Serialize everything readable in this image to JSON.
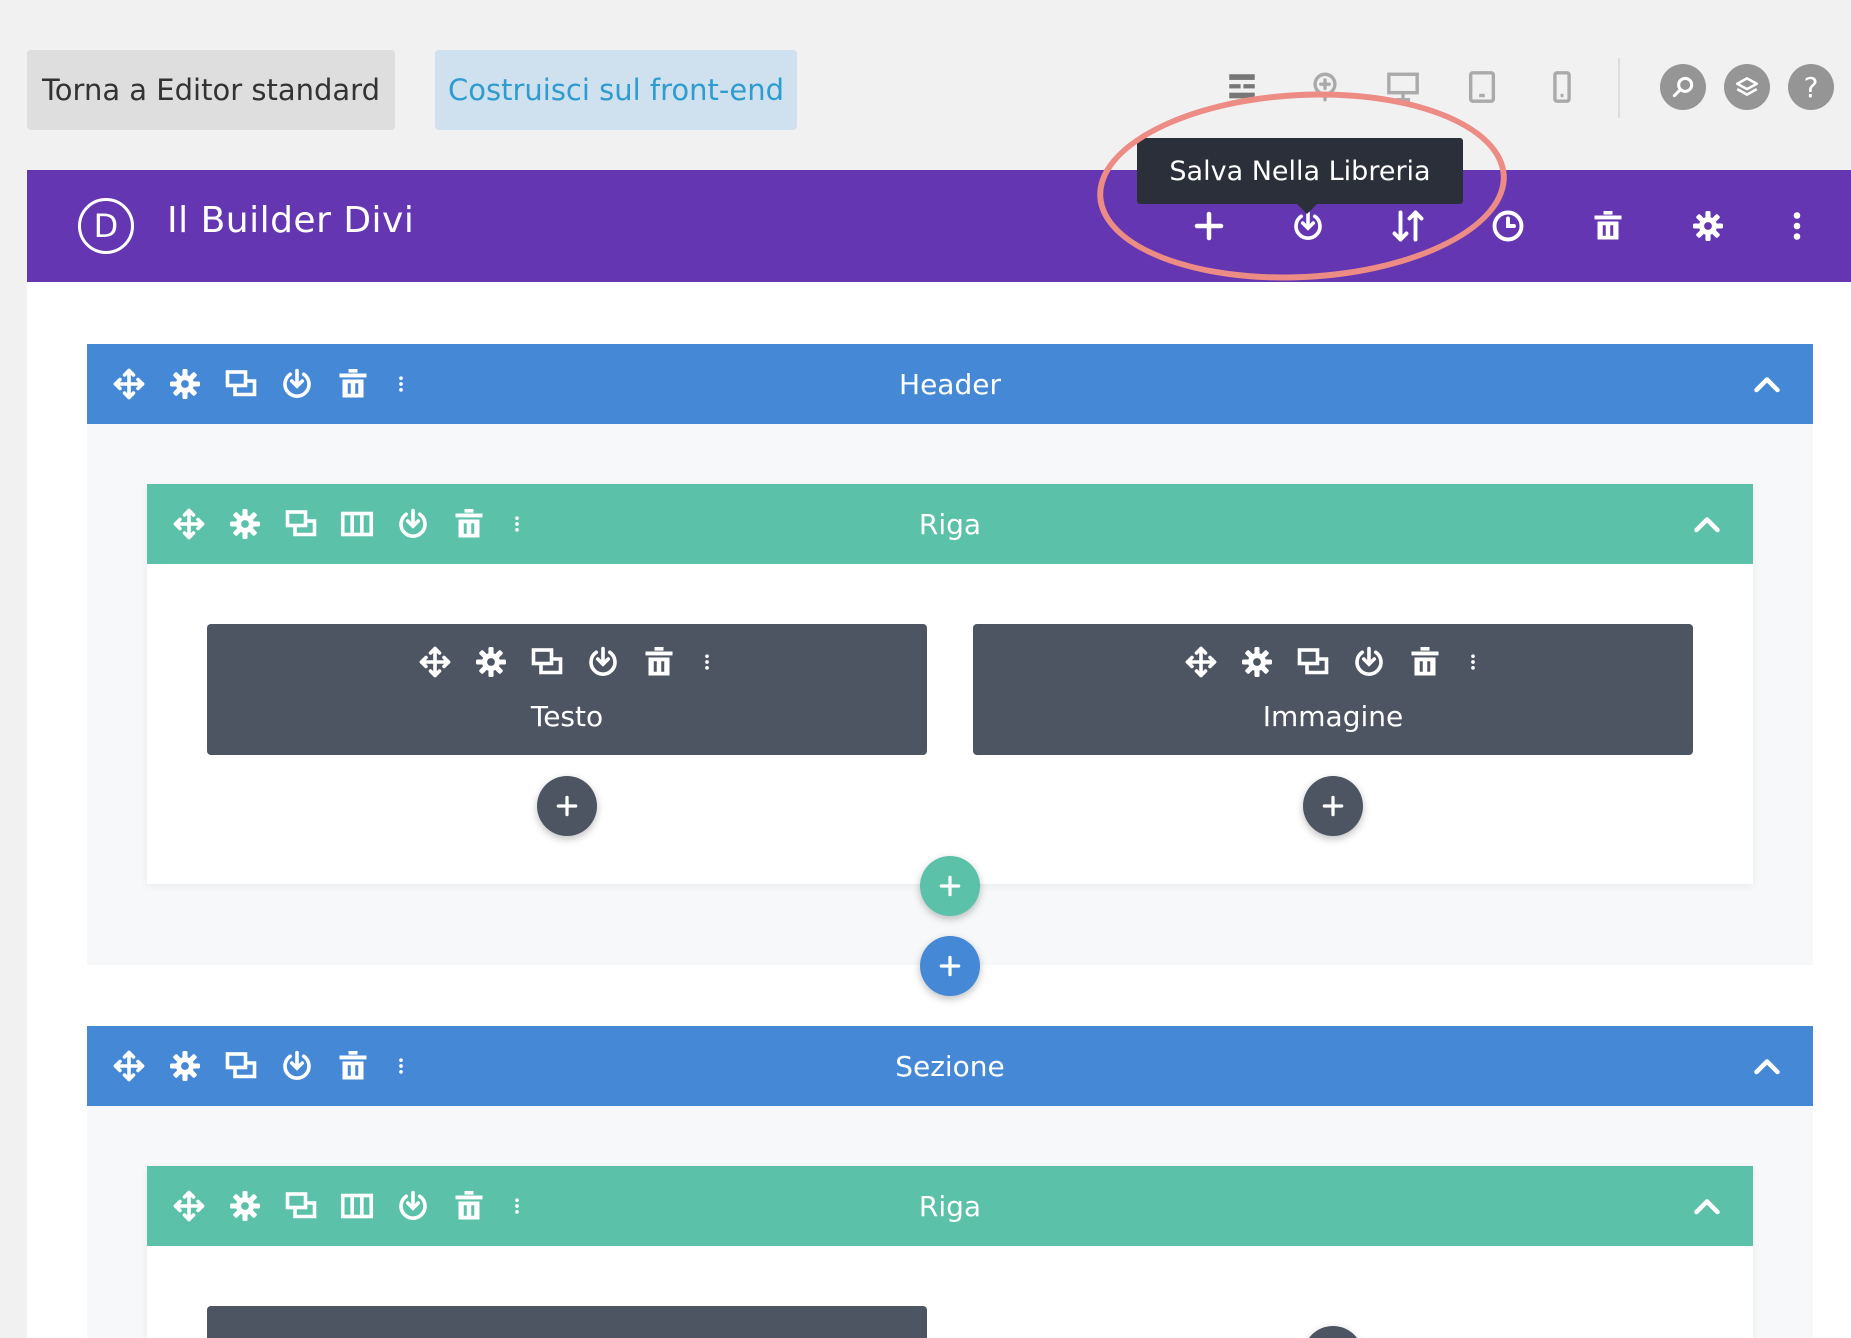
{
  "topbar": {
    "back_button": "Torna a Editor standard",
    "frontend_button": "Costruisci sul front-end"
  },
  "builder": {
    "logo_letter": "D",
    "title": "Il Builder Divi",
    "tooltip": "Salva Nella Libreria"
  },
  "sections": [
    {
      "label": "Header",
      "rows": [
        {
          "label": "Riga",
          "modules": [
            "Testo",
            "Immagine"
          ]
        }
      ]
    },
    {
      "label": "Sezione",
      "rows": [
        {
          "label": "Riga",
          "modules": []
        }
      ]
    }
  ],
  "colors": {
    "builder_bar": "#6436b1",
    "section_bar": "#4488d6",
    "row_bar": "#5bc1a8",
    "module": "#4d5563",
    "highlight": "#ec8c84"
  }
}
